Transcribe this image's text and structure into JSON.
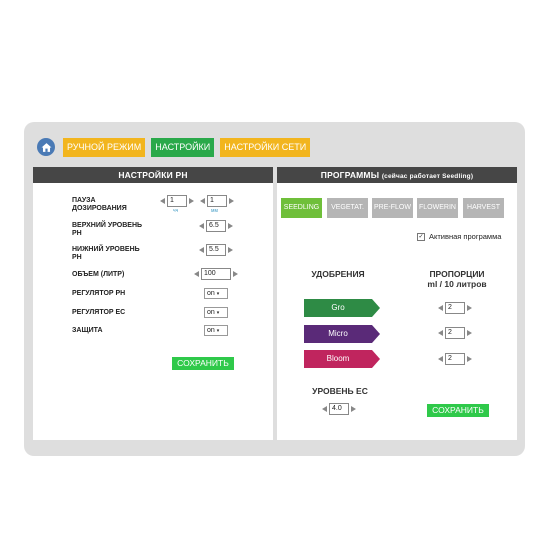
{
  "nav": {
    "manual": "РУЧНОЙ РЕЖИМ",
    "settings": "НАСТРОЙКИ",
    "network": "НАСТРОЙКИ СЕТИ"
  },
  "ph_panel": {
    "title": "НАСТРОЙКИ PH",
    "pause_label_1": "ПАУЗА",
    "pause_label_2": "ДОЗИРОВАНИЯ",
    "pause_hours": "1",
    "pause_hours_unit": "чч",
    "pause_minutes": "1",
    "pause_minutes_unit": "мм",
    "upper_label_1": "ВЕРХНИЙ УРОВЕНЬ",
    "upper_label_2": "РН",
    "upper_value": "6.5",
    "lower_label_1": "НИЖНИЙ УРОВЕНЬ",
    "lower_label_2": "РН",
    "lower_value": "5.5",
    "volume_label": "ОБЪЕМ (ЛИТР)",
    "volume_value": "100",
    "ph_reg_label": "РЕГУЛЯТОР РН",
    "ph_reg_value": "on",
    "ec_reg_label": "РЕГУЛЯТОР ЕС",
    "ec_reg_value": "on",
    "protect_label": "ЗАЩИТА",
    "protect_value": "on",
    "save": "СОХРАНИТЬ"
  },
  "programs_panel": {
    "title": "ПРОГРАММЫ",
    "subtitle": "(сейчас работает Seedling)",
    "tabs": [
      "SEEDLING",
      "VEGETAT.",
      "PRE-FLOW",
      "FLOWERIN",
      "HARVEST"
    ],
    "active_label": "Активная программа",
    "active_checked": "✓",
    "fertilizers_title": "УДОБРЕНИЯ",
    "proportions_title_1": "ПРОПОРЦИИ",
    "proportions_title_2": "ml / 10 литров",
    "fertilizers": [
      {
        "name": "Gro",
        "value": "2",
        "color": "#2e8b45"
      },
      {
        "name": "Micro",
        "value": "2",
        "color": "#5a2a78"
      },
      {
        "name": "Bloom",
        "value": "2",
        "color": "#c0255e"
      }
    ],
    "ec_title": "УРОВЕНЬ ЕС",
    "ec_value": "4.0",
    "save": "СОХРАНИТЬ"
  }
}
